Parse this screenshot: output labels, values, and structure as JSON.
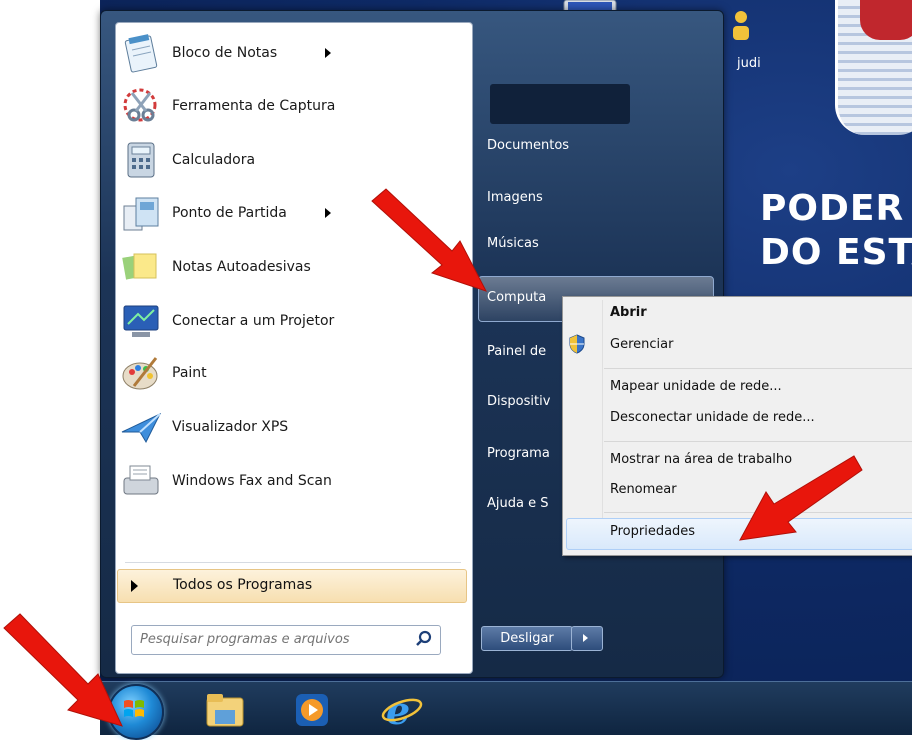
{
  "start_menu": {
    "programs": [
      {
        "label": "Bloco de Notas",
        "icon": "notepad-icon",
        "has_submenu": true
      },
      {
        "label": "Ferramenta de Captura",
        "icon": "snipping-tool-icon",
        "has_submenu": false
      },
      {
        "label": "Calculadora",
        "icon": "calculator-icon",
        "has_submenu": false
      },
      {
        "label": "Ponto de Partida",
        "icon": "getting-started-icon",
        "has_submenu": true
      },
      {
        "label": "Notas Autoadesivas",
        "icon": "sticky-notes-icon",
        "has_submenu": false
      },
      {
        "label": "Conectar a um Projetor",
        "icon": "projector-icon",
        "has_submenu": false
      },
      {
        "label": "Paint",
        "icon": "paint-icon",
        "has_submenu": false
      },
      {
        "label": "Visualizador XPS",
        "icon": "xps-viewer-icon",
        "has_submenu": false
      },
      {
        "label": "Windows Fax and Scan",
        "icon": "fax-scan-icon",
        "has_submenu": false
      }
    ],
    "all_programs_label": "Todos os Programas",
    "search_placeholder": "Pesquisar programas e arquivos",
    "right_links": {
      "documents": "Documentos",
      "images": "Imagens",
      "music": "Músicas",
      "computer": "Computa",
      "control_panel": "Painel de",
      "devices": "Dispositiv",
      "default_programs": "Programa",
      "help": "Ajuda e S"
    },
    "shutdown_label": "Desligar"
  },
  "context_menu": {
    "open": "Abrir",
    "manage": "Gerenciar",
    "map_drive": "Mapear unidade de rede...",
    "disconnect_drive": "Desconectar unidade de rede...",
    "show_desktop": "Mostrar na área de trabalho",
    "rename": "Renomear",
    "properties": "Propriedades"
  },
  "desktop": {
    "icon_label": "judi",
    "wallpaper_line1": "PODER",
    "wallpaper_line2": "DO ESTA"
  },
  "colors": {
    "annotation_arrow": "#e8160c",
    "all_programs_bg": "#f8e3b8",
    "menu_highlight": "#d9e9fb"
  }
}
